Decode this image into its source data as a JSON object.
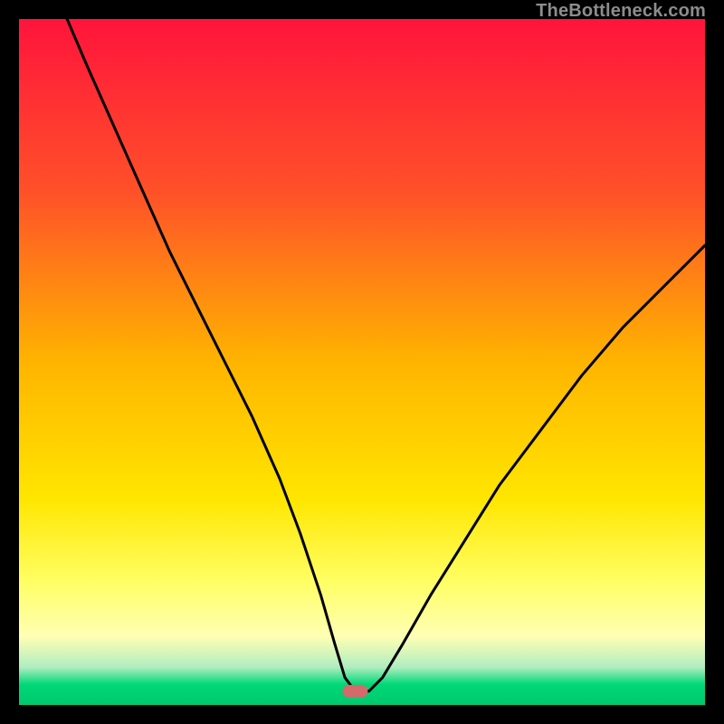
{
  "watermark": "TheBottleneck.com",
  "chart_data": {
    "type": "line",
    "title": "",
    "xlabel": "",
    "ylabel": "",
    "xlim": [
      0,
      100
    ],
    "ylim": [
      0,
      100
    ],
    "gradient_stops": [
      {
        "offset": 0.0,
        "color": "#ff143c"
      },
      {
        "offset": 0.25,
        "color": "#ff5029"
      },
      {
        "offset": 0.5,
        "color": "#ffb400"
      },
      {
        "offset": 0.7,
        "color": "#ffe600"
      },
      {
        "offset": 0.82,
        "color": "#ffff64"
      },
      {
        "offset": 0.9,
        "color": "#ffffb4"
      },
      {
        "offset": 0.945,
        "color": "#b0edc0"
      },
      {
        "offset": 0.97,
        "color": "#00d877"
      },
      {
        "offset": 1.0,
        "color": "#00c86e"
      }
    ],
    "marker": {
      "x": 49,
      "y": 2,
      "color": "#d46a6a"
    },
    "series": [
      {
        "name": "bottleneck-curve",
        "x": [
          7,
          10,
          14,
          18,
          22,
          26,
          30,
          34,
          38,
          41,
          44,
          46,
          47.5,
          49,
          51,
          53,
          56,
          60,
          65,
          70,
          76,
          82,
          88,
          94,
          100
        ],
        "y": [
          100,
          93,
          84,
          75,
          66,
          58,
          50,
          42,
          33,
          25,
          16,
          9,
          4,
          2,
          2,
          4,
          9,
          16,
          24,
          32,
          40,
          48,
          55,
          61,
          67
        ]
      }
    ]
  }
}
